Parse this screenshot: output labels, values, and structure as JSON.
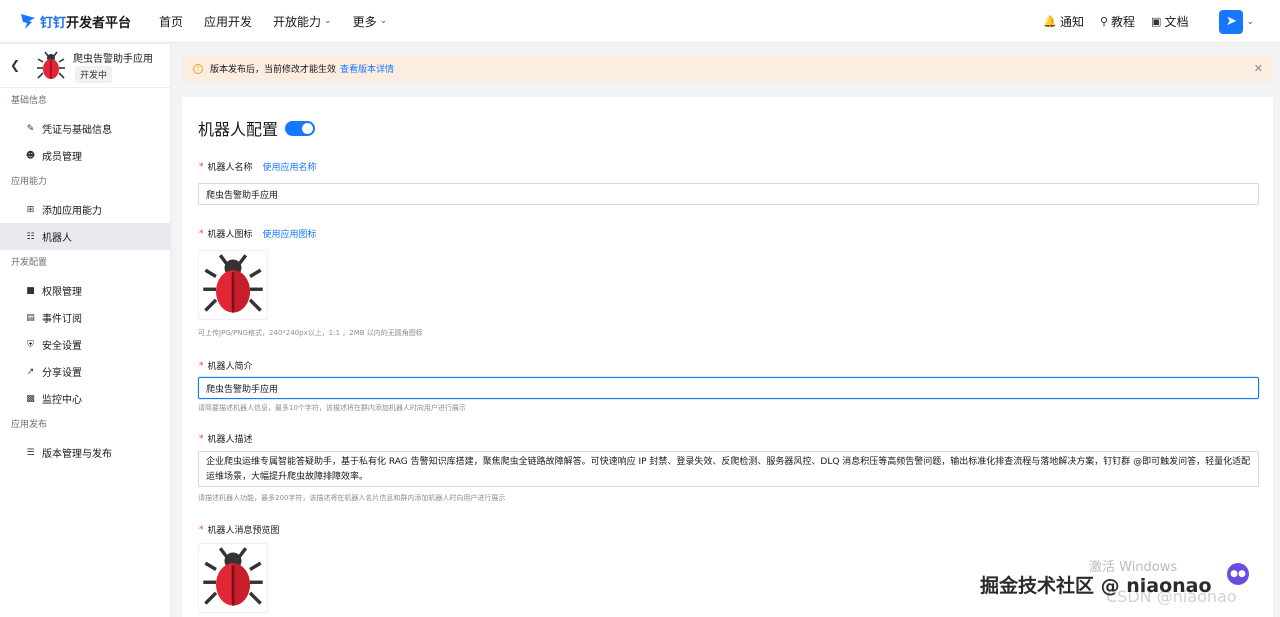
{
  "brand": {
    "logo_prefix": "钉钉",
    "logo_suffix": "开发者平台"
  },
  "nav": [
    {
      "label": "首页",
      "dropdown": false
    },
    {
      "label": "应用开发",
      "dropdown": false
    },
    {
      "label": "开放能力",
      "dropdown": true
    },
    {
      "label": "更多",
      "dropdown": true
    }
  ],
  "top_right": {
    "notify": "通知",
    "tutorial": "教程",
    "docs": "文档"
  },
  "app": {
    "name": "爬虫告警助手应用",
    "status": "开发中"
  },
  "sidebar": {
    "sections": [
      {
        "title": "基础信息",
        "items": [
          {
            "label": "凭证与基础信息",
            "icon": "credential-icon"
          },
          {
            "label": "成员管理",
            "icon": "user-icon"
          }
        ]
      },
      {
        "title": "应用能力",
        "items": [
          {
            "label": "添加应用能力",
            "icon": "grid-icon"
          },
          {
            "label": "机器人",
            "icon": "robot-icon",
            "active": true
          }
        ]
      },
      {
        "title": "开发配置",
        "items": [
          {
            "label": "权限管理",
            "icon": "lock-icon"
          },
          {
            "label": "事件订阅",
            "icon": "event-icon"
          },
          {
            "label": "安全设置",
            "icon": "shield-icon"
          },
          {
            "label": "分享设置",
            "icon": "share-icon"
          },
          {
            "label": "监控中心",
            "icon": "monitor-icon"
          }
        ]
      },
      {
        "title": "应用发布",
        "items": [
          {
            "label": "版本管理与发布",
            "icon": "layers-icon"
          }
        ]
      }
    ]
  },
  "notice": {
    "text": "版本发布后，当前修改才能生效",
    "link": "查看版本详情"
  },
  "form": {
    "title": "机器人配置",
    "enabled": true,
    "name_label": "机器人名称",
    "name_link": "使用应用名称",
    "name_value": "爬虫告警助手应用",
    "icon_label": "机器人图标",
    "icon_link": "使用应用图标",
    "icon_hint": "可上传JPG/PNG格式，240*240px以上，1:1 ，2MB 以内的无圆角图标",
    "intro_label": "机器人简介",
    "intro_value": "爬虫告警助手应用",
    "intro_hint": "请简要描述机器人信息，最多10个字符，该描述将在群内添加机器人时向用户进行展示",
    "desc_label": "机器人描述",
    "desc_value": "企业爬虫运维专属智能答疑助手，基于私有化 RAG 告警知识库搭建，聚焦爬虫全链路故障解答。可快速响应 IP 封禁、登录失效、反爬检测、服务器风控、DLQ 消息积压等高频告警问题，输出标准化排查流程与落地解决方案，钉钉群 @即可触发问答，轻量化适配运维场景，大幅提升爬虫故障排障效率。",
    "desc_hint": "请描述机器人功能，最多200字符，该描述将在机器人名片信息和群内添加机器人时向用户进行展示",
    "preview_label": "机器人消息预览图"
  },
  "overlay": {
    "windows": "激活 Windows",
    "community": "掘金技术社区 @ niaonao",
    "csdn": "CSDN @niaonao"
  },
  "colors": {
    "accent": "#1677ff",
    "required": "#e53935",
    "notice_bg": "#fbeee1",
    "bug_red": "#e32636"
  }
}
